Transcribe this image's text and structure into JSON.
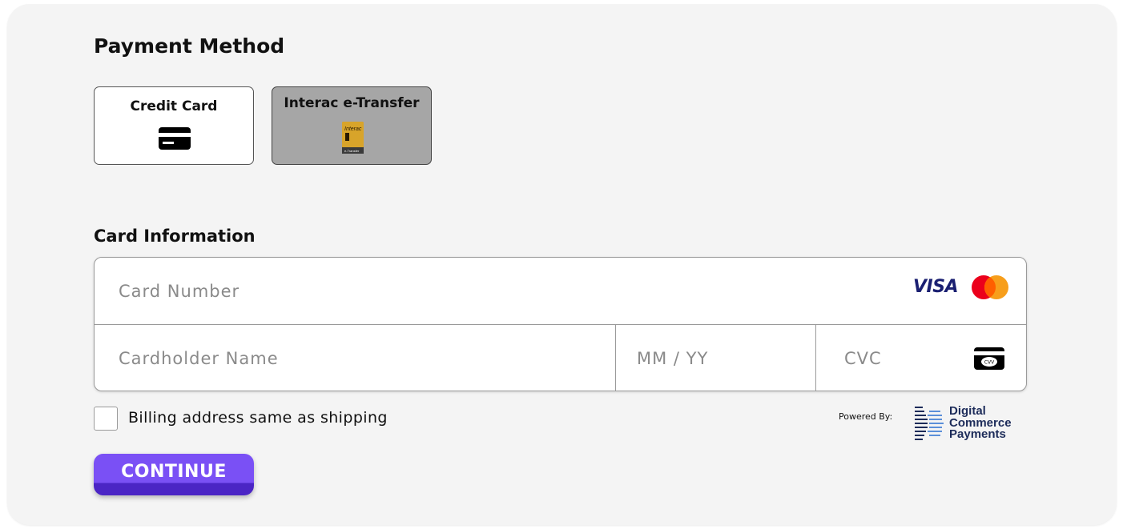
{
  "payment_method": {
    "title": "Payment Method",
    "options": [
      {
        "label": "Credit Card",
        "icon": "credit-card-icon",
        "selected": true
      },
      {
        "label": "Interac e-Transfer",
        "icon": "interac-etransfer-icon",
        "selected": false
      }
    ],
    "interac_logo_text": "Interac e-Transfer"
  },
  "card_information": {
    "title": "Card Information",
    "card_number_placeholder": "Card Number",
    "cardholder_name_placeholder": "Cardholder Name",
    "expiry_placeholder": "MM / YY",
    "cvc_placeholder": "CVC",
    "brand_visa": "VISA",
    "brand_mastercard": "mastercard-icon",
    "cvv_icon_text": "CVV"
  },
  "billing": {
    "checkbox_label": "Billing address same as shipping",
    "checked": false
  },
  "powered_by": {
    "label": "Powered By:",
    "company_lines": [
      "Digital",
      "Commerce",
      "Payments"
    ]
  },
  "actions": {
    "continue_label": "CONTINUE"
  },
  "colors": {
    "panel_bg": "#f4f4f4",
    "accent": "#7a50f5",
    "accent_dark": "#4b25c5",
    "visa_blue": "#1a1f71",
    "mc_red": "#eb001b",
    "mc_orange": "#f79e1b",
    "interac_gold": "#c9961b",
    "dcp_blue": "#1d2c5a"
  }
}
